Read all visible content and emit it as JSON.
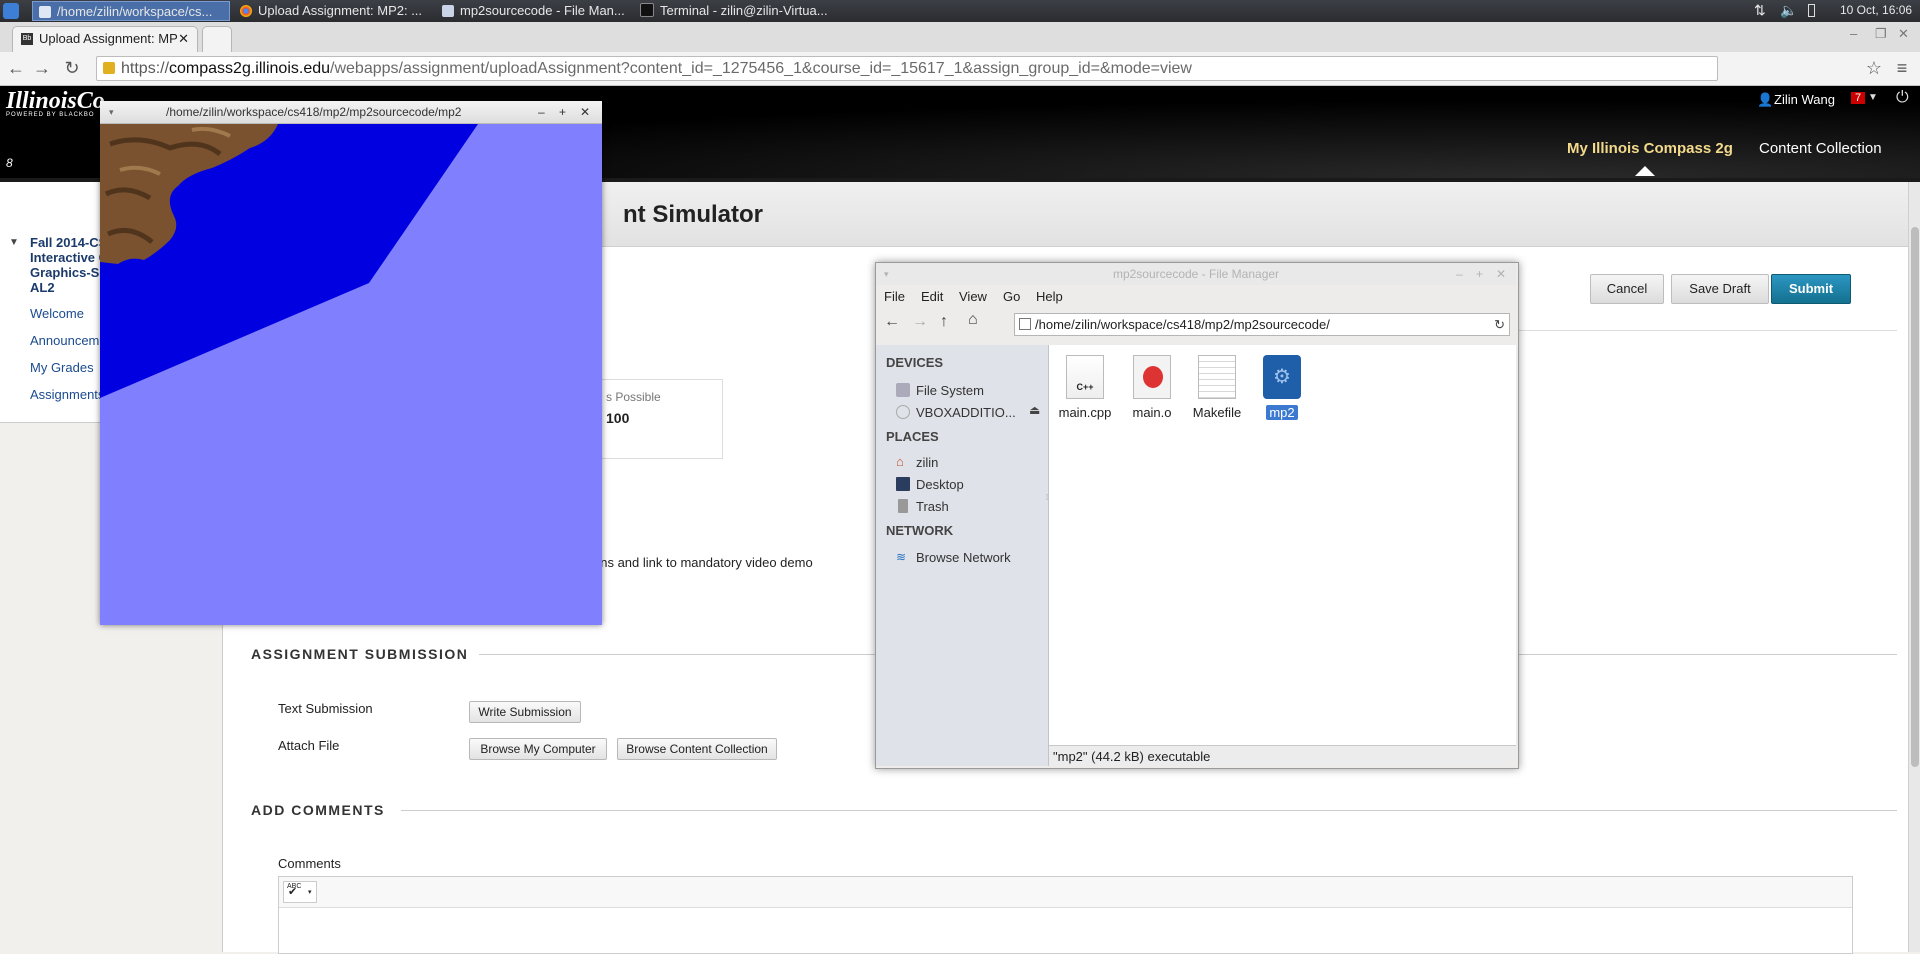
{
  "taskbar": {
    "tasks": [
      "/home/zilin/workspace/cs...",
      "Upload Assignment: MP2: ...",
      "mp2sourcecode - File Man...",
      "Terminal - zilin@zilin-Virtua..."
    ],
    "clock": "10 Oct, 16:06"
  },
  "browser": {
    "tab_title": "Upload Assignment: MP",
    "url_scheme": "https://",
    "url_host": "compass2g.illinois.edu",
    "url_path": "/webapps/assignment/uploadAssignment?content_id=_1275456_1&course_id=_15617_1&assign_group_id=&mode=view"
  },
  "bb": {
    "logo": "IllinoisCo",
    "logo_sub": "POWERED BY BLACKBO",
    "user_name": "Zilin Wang",
    "notif_count": "7",
    "nav_tabs": [
      "My Illinois Compass 2g",
      "Content Collection"
    ],
    "course_title_lines": [
      "Fall 2014-CS",
      "Interactive C",
      "Graphics-Se",
      "AL2"
    ],
    "menu": [
      "Welcome",
      "Announceme",
      "My Grades",
      "Assignments"
    ],
    "page_title": "nt Simulator",
    "buttons": {
      "cancel": "Cancel",
      "save_draft": "Save Draft",
      "submit": "Submit"
    },
    "points_label": "s Possible",
    "points_value": "100",
    "instructions_text": "ons and link to mandatory video demo",
    "section_submission": "ASSIGNMENT SUBMISSION",
    "text_submission_label": "Text Submission",
    "write_submission": "Write Submission",
    "attach_file_label": "Attach File",
    "browse_computer": "Browse My Computer",
    "browse_collection": "Browse Content Collection",
    "section_comments": "ADD COMMENTS",
    "comments_label": "Comments",
    "spell_label": "ABC"
  },
  "glwindow": {
    "title": "/home/zilin/workspace/cs418/mp2/mp2sourcecode/mp2"
  },
  "filemanager": {
    "title": "mp2sourcecode - File Manager",
    "menu": [
      "File",
      "Edit",
      "View",
      "Go",
      "Help"
    ],
    "path": "/home/zilin/workspace/cs418/mp2/mp2sourcecode/",
    "devices_header": "DEVICES",
    "devices": [
      "File System",
      "VBOXADDITIO..."
    ],
    "places_header": "PLACES",
    "places": [
      "zilin",
      "Desktop",
      "Trash"
    ],
    "network_header": "NETWORK",
    "network": [
      "Browse Network"
    ],
    "files": [
      "main.cpp",
      "main.o",
      "Makefile",
      "mp2"
    ],
    "cpp_badge": "C++",
    "status": "\"mp2\" (44.2 kB) executable"
  },
  "colors": {
    "taskbar_active": "#4a6fa8",
    "submit": "#1a7fa8",
    "gl_light": "#8080ff",
    "gl_dark": "#0000e0"
  }
}
